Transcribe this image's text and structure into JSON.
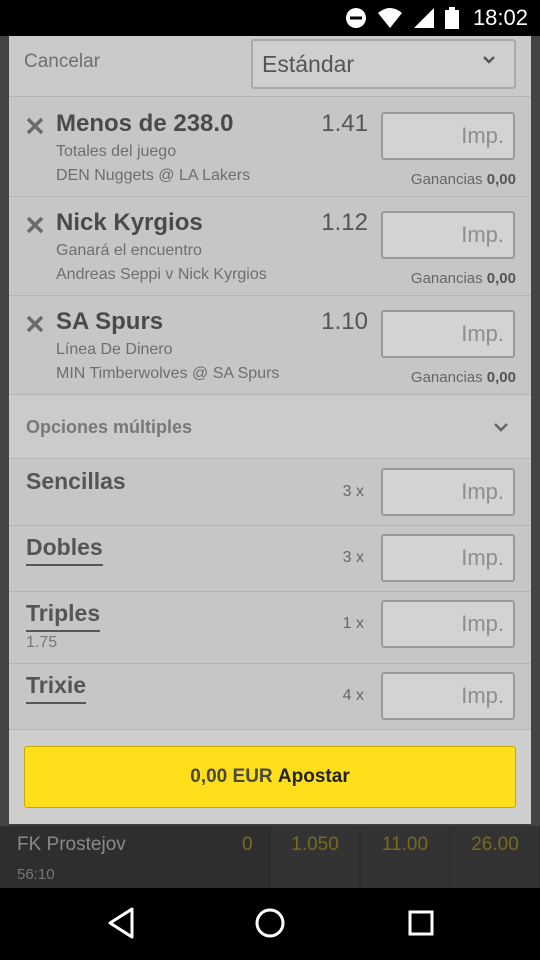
{
  "status_bar": {
    "time": "18:02"
  },
  "header": {
    "cancel_label": "Cancelar",
    "mode_select": "Estándar"
  },
  "bets": [
    {
      "selection": "Menos de 238.0",
      "market": "Totales del juego",
      "event": "DEN Nuggets @ LA Lakers",
      "odds": "1.41",
      "stake_placeholder": "Imp.",
      "winnings_label": "Ganancias",
      "winnings_value": "0,00"
    },
    {
      "selection": "Nick Kyrgios",
      "market": "Ganará el encuentro",
      "event": "Andreas Seppi v Nick Kyrgios",
      "odds": "1.12",
      "stake_placeholder": "Imp.",
      "winnings_label": "Ganancias",
      "winnings_value": "0,00"
    },
    {
      "selection": "SA Spurs",
      "market": "Línea De Dinero",
      "event": "MIN Timberwolves @ SA Spurs",
      "odds": "1.10",
      "stake_placeholder": "Imp.",
      "winnings_label": "Ganancias",
      "winnings_value": "0,00"
    }
  ],
  "multiples": {
    "title": "Opciones múltiples",
    "rows": [
      {
        "name": "Sencillas",
        "count": "3 x",
        "stake_placeholder": "Imp.",
        "sub": ""
      },
      {
        "name": "Dobles",
        "count": "3 x",
        "stake_placeholder": "Imp.",
        "sub": ""
      },
      {
        "name": "Triples",
        "count": "1 x",
        "stake_placeholder": "Imp.",
        "sub": "1.75"
      },
      {
        "name": "Trixie",
        "count": "4 x",
        "stake_placeholder": "Imp.",
        "sub": ""
      }
    ]
  },
  "place_bet": {
    "amount": "0,00 EUR",
    "label": "Apostar"
  },
  "background_event": {
    "team": "FK Prostejov",
    "clock": "56:10",
    "score": "0",
    "odds": [
      "1.050",
      "11.00",
      "26.00"
    ]
  },
  "colors": {
    "accent": "#ffdf1b",
    "modal_bg": "#c8c8c8"
  }
}
